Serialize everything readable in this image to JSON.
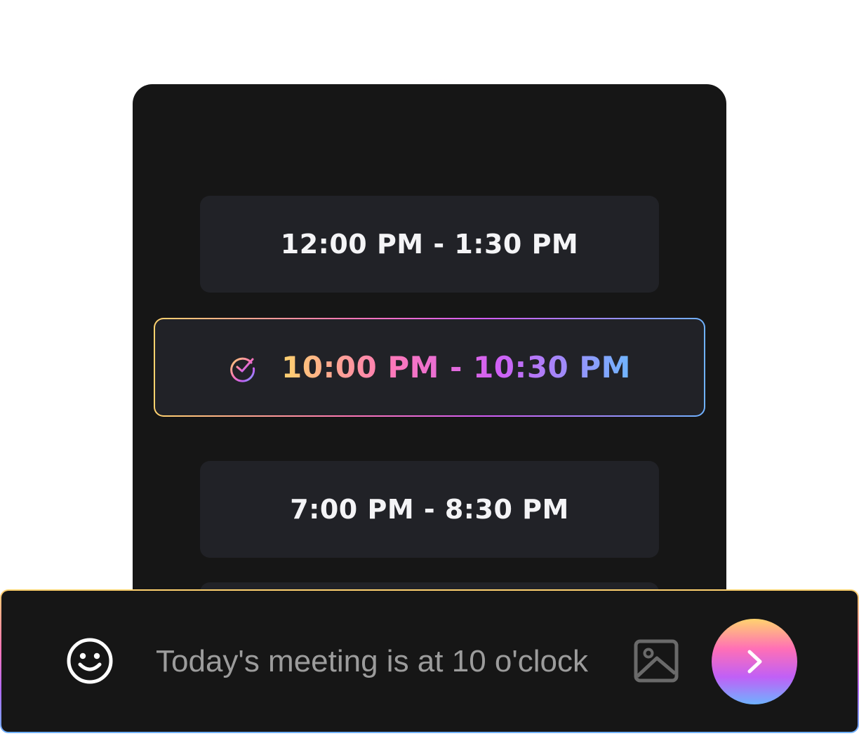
{
  "time_slots": [
    {
      "label": "12:00 PM - 1:30 PM",
      "selected": false
    },
    {
      "label": "10:00 PM - 10:30 PM",
      "selected": true
    },
    {
      "label": "7:00 PM - 8:30 PM",
      "selected": false
    }
  ],
  "composer": {
    "value": "Today's meeting is at 10 o'clock",
    "emoji_icon": "smiley-icon",
    "image_icon": "image-icon",
    "send_icon": "chevron-right-icon"
  },
  "colors": {
    "panel_background": "#161616",
    "slot_background": "#212227",
    "gradient_start": "#ffd36e",
    "gradient_mid_pink": "#ff78b4",
    "gradient_mid_purple": "#d25cf5",
    "gradient_end": "#6fb2ff",
    "placeholder_text": "#9c9c9c"
  }
}
